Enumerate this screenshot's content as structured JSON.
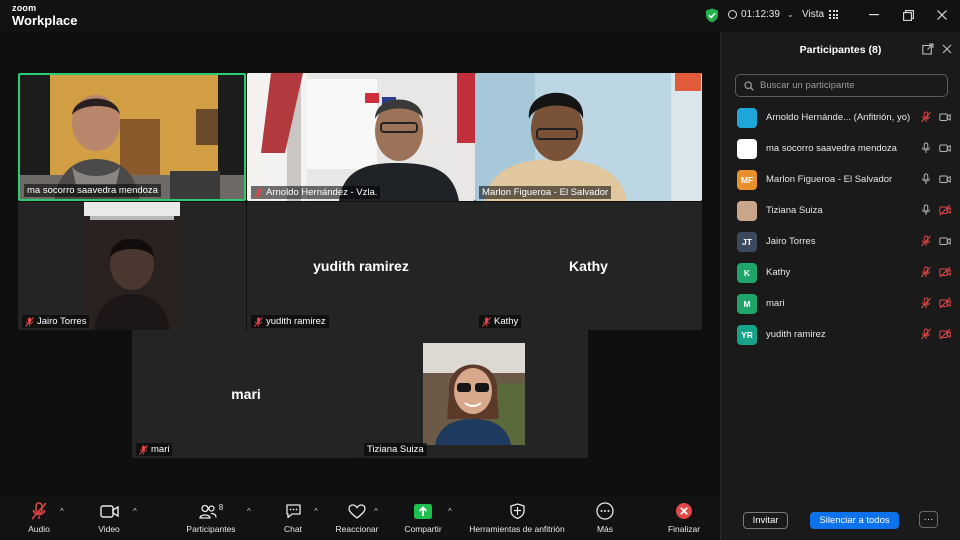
{
  "app": {
    "brand_top": "zoom",
    "brand_bottom": "Workplace"
  },
  "titlebar": {
    "timer": "01:12:39",
    "view_label": "Vista"
  },
  "tiles": [
    {
      "name": "ma socorro saavedra mendoza",
      "big": "",
      "muted": false
    },
    {
      "name": "Arnoldo Hernández - Vzla.",
      "big": "",
      "muted": true
    },
    {
      "name": "Marlon Figueroa - El Salvador",
      "big": "",
      "muted": false
    },
    {
      "name": "Jairo Torres",
      "big": "",
      "muted": true
    },
    {
      "name": "yudith ramirez",
      "big": "yudith ramirez",
      "muted": true
    },
    {
      "name": "Kathy",
      "big": "Kathy",
      "muted": true
    },
    {
      "name": "mari",
      "big": "mari",
      "muted": true
    },
    {
      "name": "Tiziana Suiza",
      "big": "",
      "muted": false
    }
  ],
  "panel": {
    "title": "Participantes (8)",
    "search_placeholder": "Buscar un participante",
    "participants": [
      {
        "initials": "",
        "name": "Arnoldo Hernánde... (Anfitrión, yo)",
        "avatar_color": "#1fa6d8",
        "mic_muted": true,
        "video_off": false
      },
      {
        "initials": "",
        "name": "ma socorro saavedra mendoza",
        "avatar_color": "#ffffff",
        "mic_muted": false,
        "video_off": false
      },
      {
        "initials": "MF",
        "name": "Marlon Figueroa - El Salvador",
        "avatar_color": "#e8912b",
        "mic_muted": false,
        "video_off": false
      },
      {
        "initials": "",
        "name": "Tiziana Suiza",
        "avatar_color": "#c9a58a",
        "mic_muted": false,
        "video_off": true
      },
      {
        "initials": "JT",
        "name": "Jairo Torres",
        "avatar_color": "#3a4a5c",
        "mic_muted": true,
        "video_off": false
      },
      {
        "initials": "K",
        "name": "Kathy",
        "avatar_color": "#1fa56a",
        "mic_muted": true,
        "video_off": true
      },
      {
        "initials": "M",
        "name": "mari",
        "avatar_color": "#1fa56a",
        "mic_muted": true,
        "video_off": true
      },
      {
        "initials": "YR",
        "name": "yudith ramirez",
        "avatar_color": "#16a38a",
        "mic_muted": true,
        "video_off": true
      }
    ],
    "invite_label": "Invitar",
    "mute_all_label": "Silenciar a todos",
    "more_label": "···"
  },
  "toolbar": {
    "audio": "Audio",
    "video": "Video",
    "participants": "Participantes",
    "participants_count": "8",
    "chat": "Chat",
    "react": "Reaccionar",
    "share": "Compartir",
    "host_tools": "Herramientas de anfitrión",
    "more": "Más",
    "end": "Finalizar"
  },
  "colors": {
    "active_speaker": "#2ecc71",
    "mute_red": "#e24646",
    "accent_blue": "#0e72ed",
    "share_green": "#1fbf4f"
  }
}
